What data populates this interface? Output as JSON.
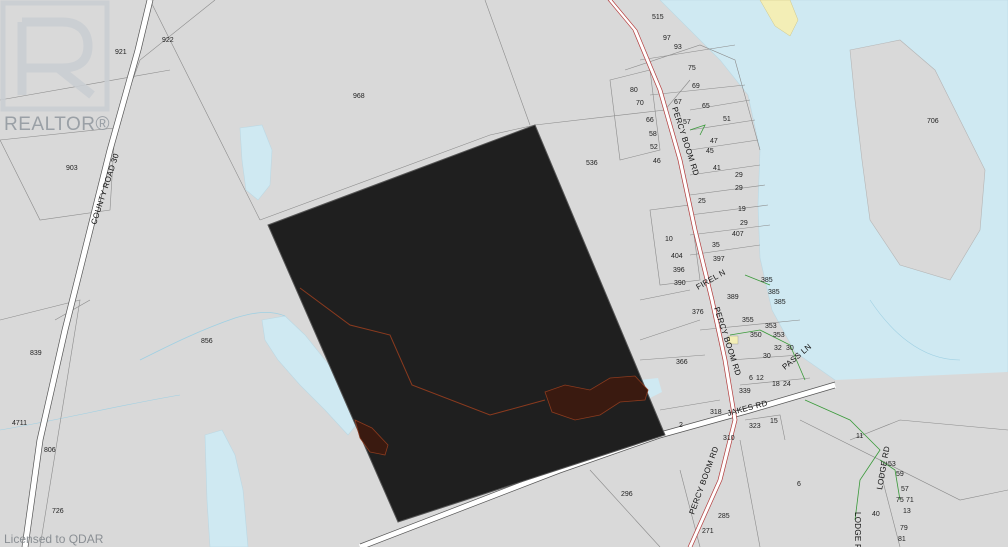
{
  "brand": {
    "name": "REALTOR®",
    "license": "Licensed to QDAR"
  },
  "colors": {
    "land": "#d9d9d9",
    "water": "#cfe9f2",
    "parcel": "#1f1f1f",
    "road": "#b23b3b",
    "trail": "#3a9a3a",
    "wetland": "#3a1a10"
  },
  "roads": [
    "COUNTY ROAD 30",
    "PERCY BOOM RD",
    "JAKES RD",
    "PERCY BOOM RD",
    "PERCY BOOM RD",
    "FIREL N",
    "PASS LN",
    "LODGE RD",
    "LODGE RD"
  ],
  "parcels": [
    "921",
    "922",
    "968",
    "515",
    "97",
    "93",
    "75",
    "69",
    "80",
    "70",
    "67",
    "65",
    "66",
    "57",
    "51",
    "58",
    "47",
    "52",
    "45",
    "46",
    "41",
    "903",
    "536",
    "29",
    "29",
    "25",
    "19",
    "29",
    "10",
    "407",
    "35",
    "397",
    "404",
    "396",
    "390",
    "385",
    "389",
    "385",
    "385",
    "376",
    "839",
    "355",
    "366",
    "353",
    "350",
    "353",
    "30",
    "856",
    "32",
    "30",
    "6",
    "12",
    "18",
    "24",
    "339",
    "4711",
    "318",
    "323",
    "15",
    "2",
    "310",
    "11",
    "706",
    "806",
    "53",
    "59",
    "57",
    "75",
    "71",
    "13",
    "40",
    "79",
    "726",
    "296",
    "285",
    "271",
    "81",
    "6"
  ]
}
